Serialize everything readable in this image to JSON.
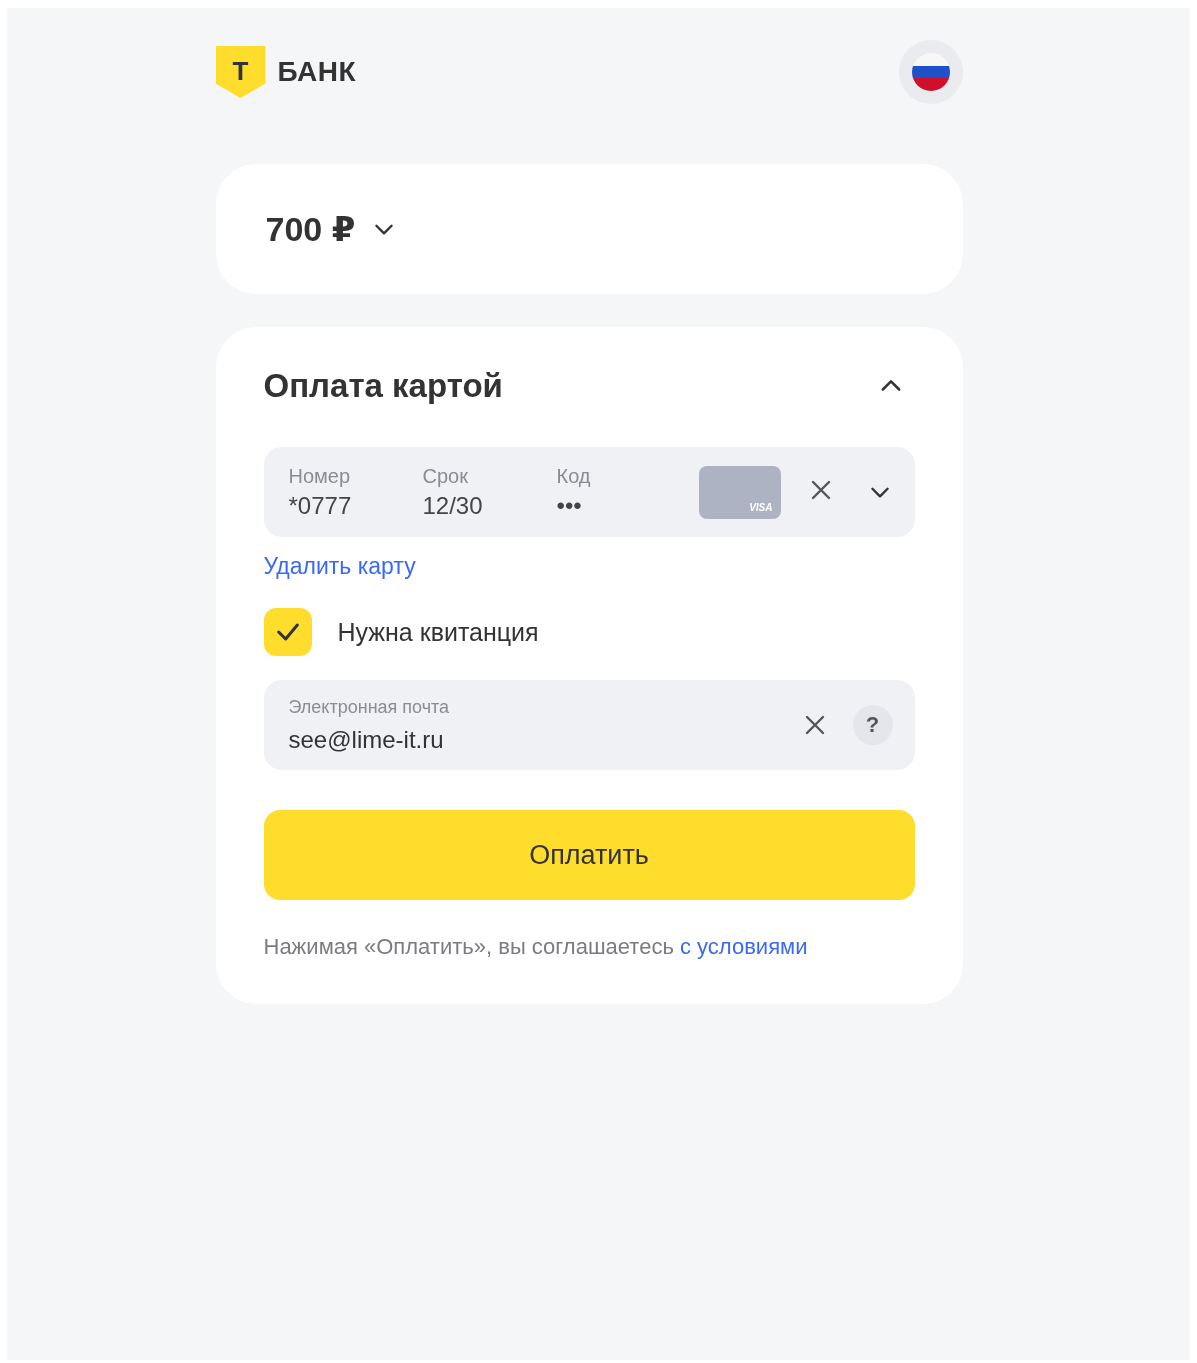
{
  "header": {
    "logo_letter": "Т",
    "logo_text": "БАНК"
  },
  "amount": {
    "value": "700 ₽",
    "expanded": false
  },
  "payment": {
    "title": "Оплата картой",
    "expanded": true,
    "card": {
      "fields": [
        {
          "label": "Номер",
          "value": "*0777"
        },
        {
          "label": "Срок",
          "value": "12/30"
        },
        {
          "label": "Код",
          "value": "•••"
        }
      ],
      "brand": "VISA"
    },
    "remove_link": "Удалить карту",
    "receipt": {
      "label": "Нужна квитанция",
      "checked": true
    },
    "email": {
      "label": "Электронная почта",
      "value": "see@lime-it.ru",
      "help": "?"
    },
    "pay_button": "Оплатить",
    "terms": {
      "text": "Нажимая «Оплатить», вы соглашаетесь",
      "link": "с условиями"
    }
  }
}
